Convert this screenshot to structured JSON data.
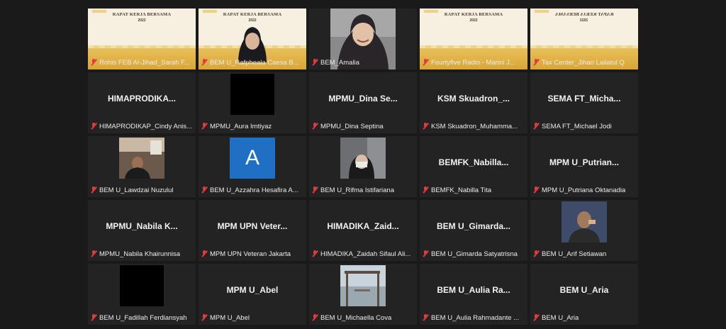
{
  "tiles": [
    {
      "type": "slide",
      "label": "Rohis FEB Al-Jihad_Sarah F...",
      "banner": "RAPAT KERJA BERSAMA",
      "year": "2022"
    },
    {
      "type": "slide-person",
      "label": "BEM U_Rafpheala Caesa B...",
      "banner": "RAPAT KERJA BERSAMA",
      "year": "2022"
    },
    {
      "type": "camera",
      "label": "BEM_Amalia"
    },
    {
      "type": "slide",
      "label": "Fourtyfive Radio - Marini J...",
      "banner": "RAPAT KERJA BERSAMA",
      "year": "2022"
    },
    {
      "type": "slide-mirror",
      "label": "Tax Center_Jihan Lailatul Q",
      "banner": "RAPAT KERJA BERSAMA",
      "year": "2022"
    },
    {
      "type": "name",
      "display": "HIMAPRODIKA...",
      "label": "HIMAPRODIKAP_Cindy Anis..."
    },
    {
      "type": "black",
      "label": "MPMU_Aura Imtiyaz"
    },
    {
      "type": "name",
      "display": "MPMU_Dina  Se...",
      "label": "MPMU_Dina Septina"
    },
    {
      "type": "name",
      "display": "KSM  Skuadron_...",
      "label": "KSM Skuadron_Muhamma..."
    },
    {
      "type": "name",
      "display": "SEMA  FT_Micha...",
      "label": "SEMA FT_Michael Jodi"
    },
    {
      "type": "video",
      "label": "BEM U_Lawdzai Nuzulul"
    },
    {
      "type": "avatar",
      "letter": "A",
      "label": "BEM U_Azzahra Hesafira A..."
    },
    {
      "type": "video",
      "label": "BEM U_Rifma Istifariana"
    },
    {
      "type": "name",
      "display": "BEMFK_Nabilla...",
      "label": "BEMFK_Nabilla Tita"
    },
    {
      "type": "name",
      "display": "MPM  U_Putrian...",
      "label": "MPM U_Putriana Oktanadia"
    },
    {
      "type": "name",
      "display": "MPMU_Nabila  K...",
      "label": "MPMU_Nabila Khairunnisa"
    },
    {
      "type": "name",
      "display": "MPM  UPN  Veter...",
      "label": "MPM UPN Veteran Jakarta"
    },
    {
      "type": "name",
      "display": "HIMADIKA_Zaid...",
      "label": "HIMADIKA_Zaidah Sifaul Ali..."
    },
    {
      "type": "name",
      "display": "BEM  U_Gimarda...",
      "label": "BEM U_Gimarda Satyatrisna"
    },
    {
      "type": "video",
      "label": "BEM U_Arif Setiawan"
    },
    {
      "type": "black",
      "label": "BEM U_Fadillah Ferdiansyah"
    },
    {
      "type": "name",
      "display": "MPM U_Abel",
      "label": "MPM U_Abel"
    },
    {
      "type": "video",
      "label": "BEM U_Michaella Cova"
    },
    {
      "type": "name",
      "display": "BEM  U_Aulia  Ra...",
      "label": "BEM U_Aulia Rahmadante ..."
    },
    {
      "type": "name",
      "display": "BEM U_Aria",
      "label": "BEM U_Aria"
    }
  ],
  "colors": {
    "muted": "#e23b3b",
    "background": "#1a1a1a",
    "tile": "#232323"
  }
}
